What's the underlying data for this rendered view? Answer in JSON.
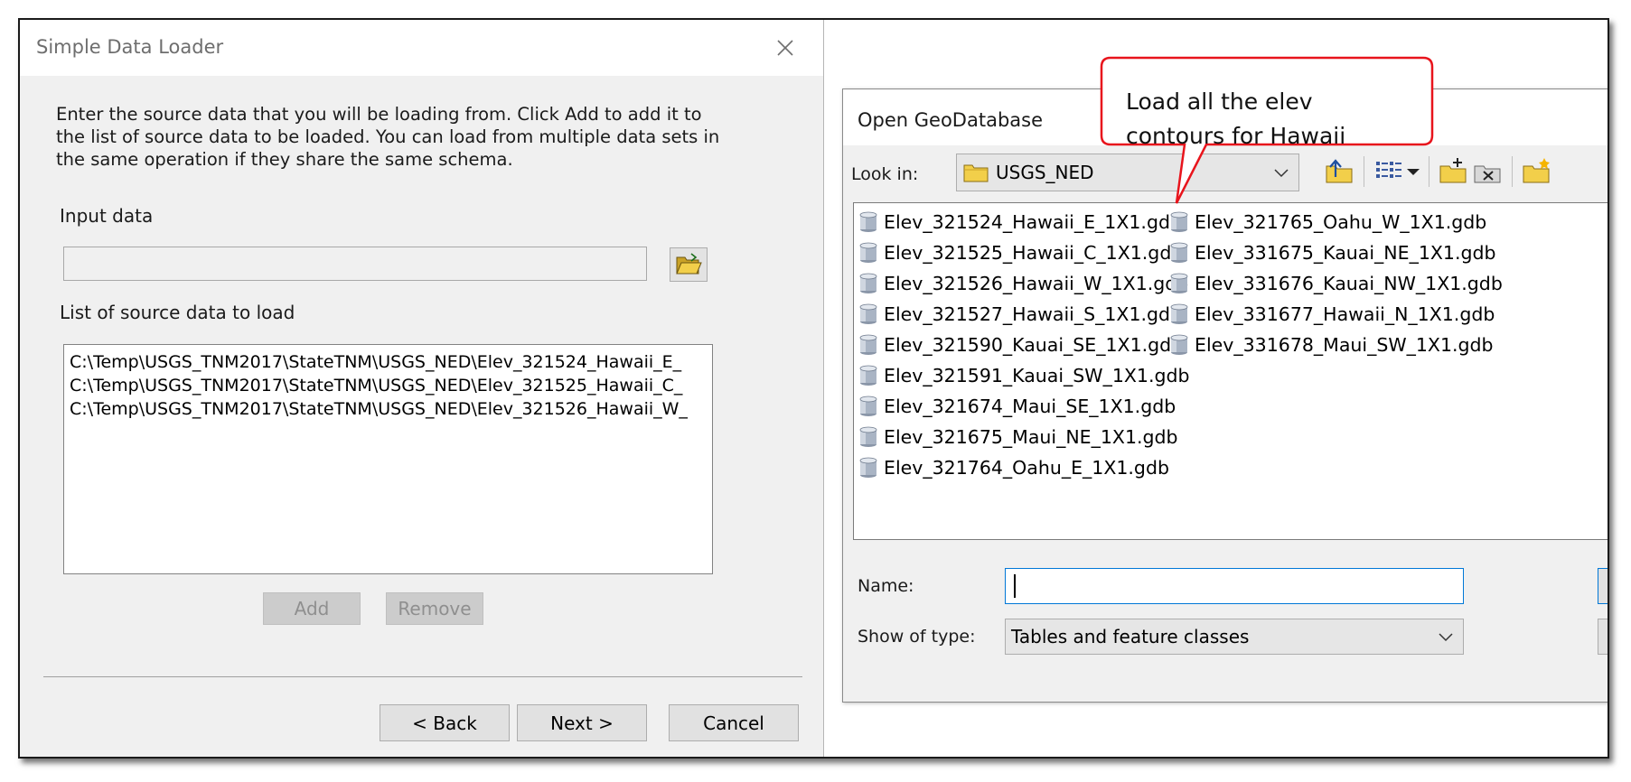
{
  "simple_data_loader": {
    "title": "Simple Data Loader",
    "description_lines": [
      "Enter the source data that you will be loading from. Click Add to add it to",
      "the list of source data to be loaded. You can load from multiple data sets in",
      "the same operation if they share the same schema."
    ],
    "input_data_label": "Input data",
    "input_data_value": "",
    "list_label": "List of source data to load",
    "source_items": [
      "C:\\Temp\\USGS_TNM2017\\StateTNM\\USGS_NED\\Elev_321524_Hawaii_E_",
      "C:\\Temp\\USGS_TNM2017\\StateTNM\\USGS_NED\\Elev_321525_Hawaii_C_",
      "C:\\Temp\\USGS_TNM2017\\StateTNM\\USGS_NED\\Elev_321526_Hawaii_W_"
    ],
    "add_label": "Add",
    "remove_label": "Remove",
    "back_label": "< Back",
    "next_label": "Next >",
    "cancel_label": "Cancel"
  },
  "open_geodatabase": {
    "title": "Open GeoDatabase",
    "look_in_label": "Look in:",
    "look_in_value": "USGS_NED",
    "files_col1": [
      "Elev_321524_Hawaii_E_1X1.gdb",
      "Elev_321525_Hawaii_C_1X1.gdb",
      "Elev_321526_Hawaii_W_1X1.gdb",
      "Elev_321527_Hawaii_S_1X1.gdb",
      "Elev_321590_Kauai_SE_1X1.gdb",
      "Elev_321591_Kauai_SW_1X1.gdb",
      "Elev_321674_Maui_SE_1X1.gdb",
      "Elev_321675_Maui_NE_1X1.gdb",
      "Elev_321764_Oahu_E_1X1.gdb"
    ],
    "files_col2": [
      "Elev_321765_Oahu_W_1X1.gdb",
      "Elev_331675_Kauai_NE_1X1.gdb",
      "Elev_331676_Kauai_NW_1X1.gdb",
      "Elev_331677_Hawaii_N_1X1.gdb",
      "Elev_331678_Maui_SW_1X1.gdb"
    ],
    "name_label": "Name:",
    "name_value": "",
    "type_label": "Show of type:",
    "type_value": "Tables and feature classes"
  },
  "callout": {
    "lines": [
      "Load all the elev",
      "contours for Hawaii"
    ],
    "border_color": "#e8141c"
  },
  "icons": {
    "dialog_close": "close-icon",
    "browse": "open-folder-icon",
    "look_in_folder": "folder-icon",
    "up_one_level": "up-folder-icon",
    "view_menu": "list-view-icon",
    "connect_folder": "connect-folder-icon",
    "disconnect_folder": "disconnect-folder-icon",
    "new_folder": "new-folder-icon",
    "geodatabase": "geodatabase-icon"
  }
}
